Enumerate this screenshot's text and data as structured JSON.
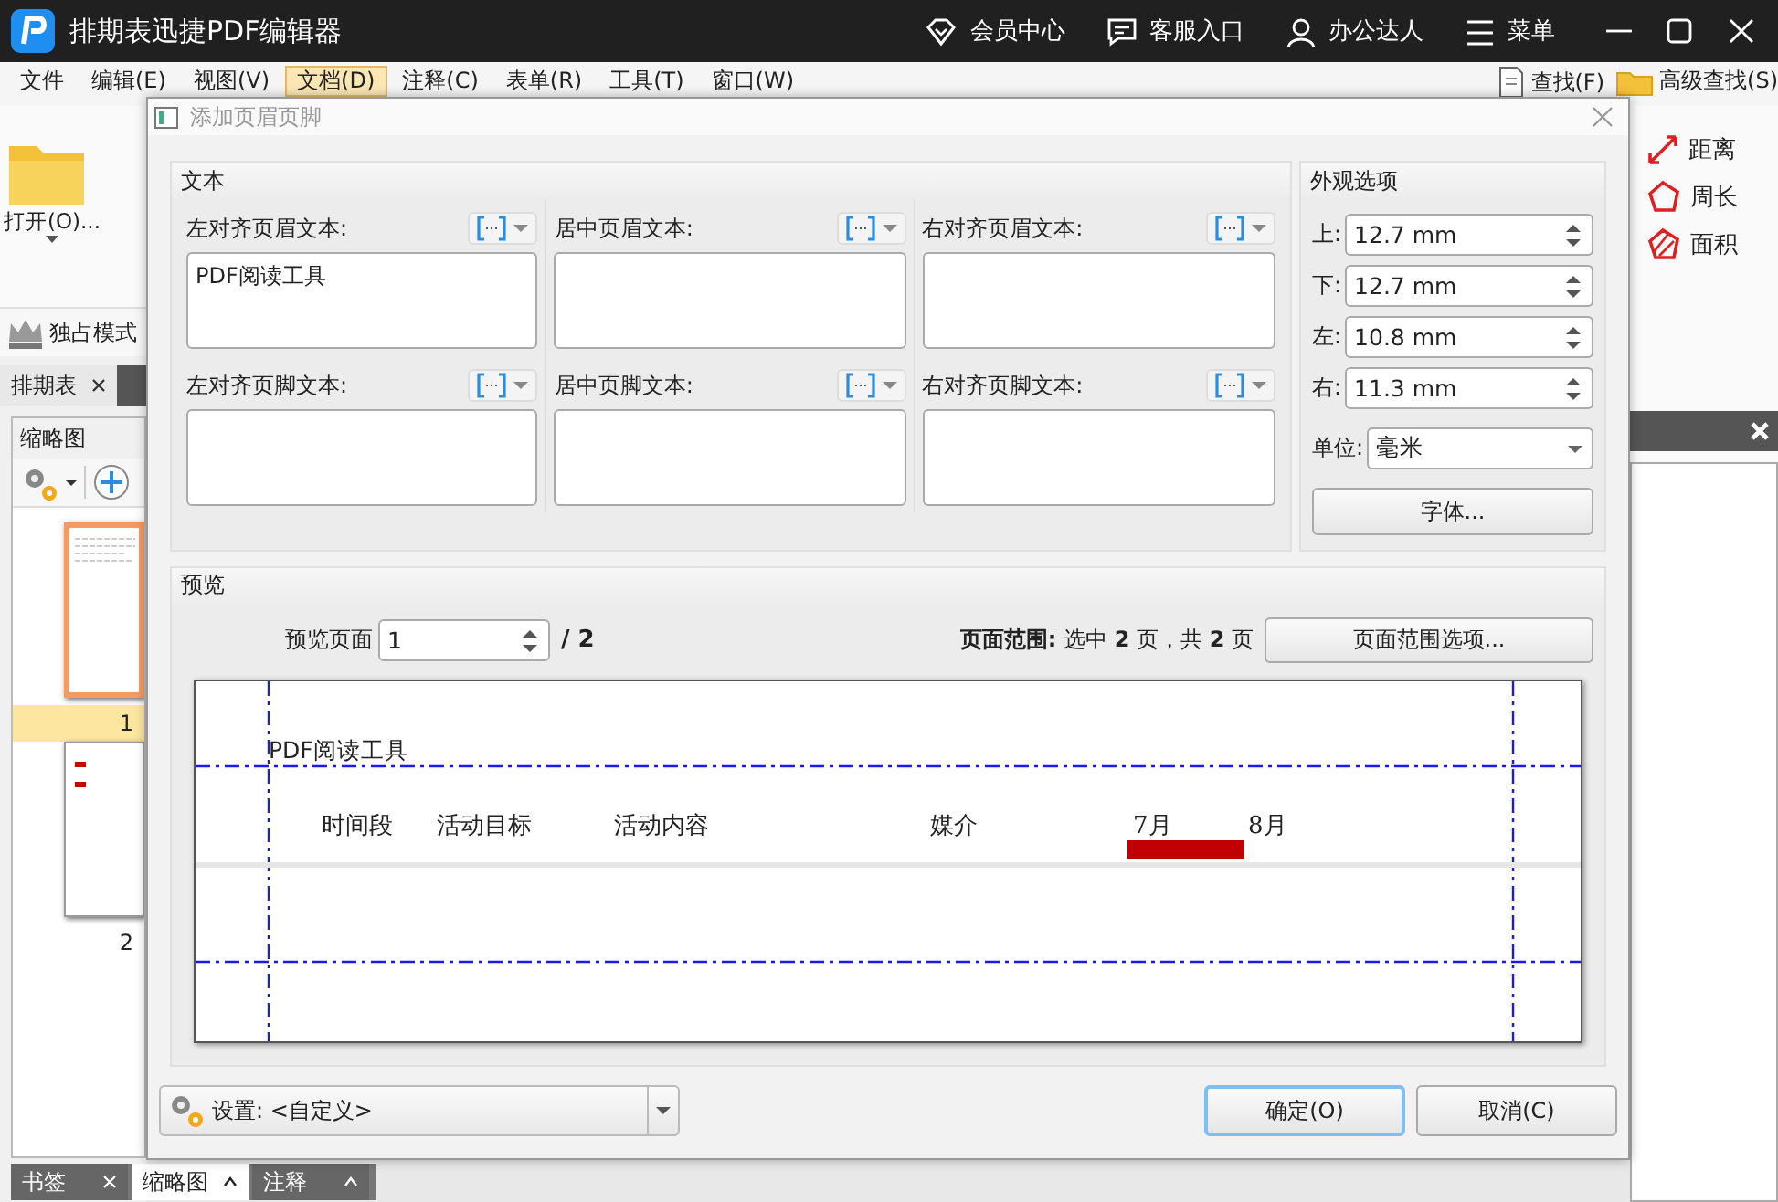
{
  "title_bar": {
    "title": "排期表迅捷PDF编辑器",
    "actions": [
      {
        "kind": "vip",
        "label": "会员中心"
      },
      {
        "kind": "chat",
        "label": "客服入口"
      },
      {
        "kind": "user",
        "label": "办公达人"
      },
      {
        "kind": "menu",
        "label": "菜单"
      }
    ]
  },
  "menu_bar": {
    "items": [
      {
        "label": "文件",
        "selected": false
      },
      {
        "label": "编辑(E)",
        "selected": false
      },
      {
        "label": "视图(V)",
        "selected": false
      },
      {
        "label": "文档(D)",
        "selected": true
      },
      {
        "label": "注释(C)",
        "selected": false
      },
      {
        "label": "表单(R)",
        "selected": false
      },
      {
        "label": "工具(T)",
        "selected": false
      },
      {
        "label": "窗口(W)",
        "selected": false
      }
    ],
    "right_items": [
      {
        "kind": "find",
        "label": "查找(F)"
      },
      {
        "kind": "advanced_find",
        "label": "高级查找(S)"
      }
    ]
  },
  "toolbar": {
    "open_button": "打开(O)...",
    "exclusive_mode": "独占模式"
  },
  "document_tabs": [
    {
      "label": "排期表",
      "selected": true
    }
  ],
  "thumbnail_panel": {
    "title": "缩略图",
    "pages": [
      {
        "label": "1",
        "selected": true
      },
      {
        "label": "2",
        "selected": false
      }
    ]
  },
  "panel_tabs": [
    {
      "label": "书签",
      "selected": false
    },
    {
      "label": "缩略图",
      "selected": true
    },
    {
      "label": "注释",
      "selected": false
    }
  ],
  "measure_tools": [
    {
      "kind": "distance",
      "label": "距离"
    },
    {
      "kind": "perimeter",
      "label": "周长"
    },
    {
      "kind": "area",
      "label": "面积"
    }
  ],
  "dialog": {
    "title": "添加页眉页脚",
    "text_group": {
      "title": "文本",
      "fields": [
        {
          "label": "左对齐页眉文本:",
          "value": "PDF阅读工具"
        },
        {
          "label": "居中页眉文本:"
        },
        {
          "label": "右对齐页眉文本:"
        },
        {
          "label": "左对齐页脚文本:"
        },
        {
          "label": "居中页脚文本:"
        },
        {
          "label": "右对齐页脚文本:"
        }
      ]
    },
    "appearance": {
      "title": "外观选项",
      "margins": [
        {
          "label": "上:",
          "value": "12.7 mm"
        },
        {
          "label": "下:",
          "value": "12.7 mm"
        },
        {
          "label": "左:",
          "value": "10.8 mm"
        },
        {
          "label": "右:",
          "value": "11.3 mm"
        }
      ],
      "unit": {
        "label": "单位:",
        "value": "毫米"
      },
      "font_button": "字体..."
    },
    "preview": {
      "title": "预览",
      "page_label": "预览页面",
      "page_value": "1",
      "page_total": "/ 2",
      "range": "**页面范围:** 选中 **2** 页，共 **2** 页",
      "range_button": "页面范围选项...",
      "page": {
        "header_text": "PDF阅读工具",
        "columns": [
          "时间段",
          "活动目标",
          "活动内容",
          "媒介",
          "7月",
          "8月"
        ]
      }
    },
    "settings": {
      "label": "设置: <自定义>"
    },
    "buttons": [
      {
        "label": "确定(O)",
        "selected": true
      },
      {
        "label": "取消(C)",
        "selected": false
      }
    ]
  }
}
